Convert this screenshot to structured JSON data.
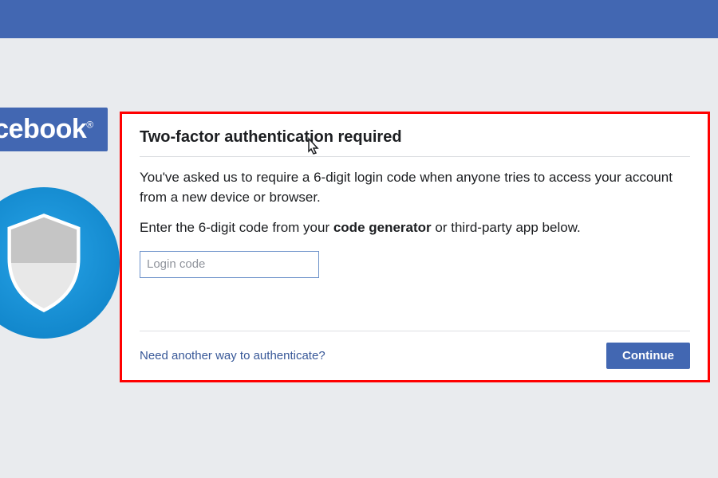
{
  "brand": {
    "name": "facebook",
    "icon_name": "shield-icon"
  },
  "dialog": {
    "heading": "Two-factor authentication required",
    "description_line1": "You've asked us to require a 6-digit login code when anyone tries to access your account from a new device or browser.",
    "enter_prefix": "Enter the 6-digit code from your ",
    "code_generator_label": "code generator",
    "enter_suffix": " or third-party app below.",
    "input_placeholder": "Login code",
    "alt_auth_link": "Need another way to authenticate?",
    "continue_label": "Continue"
  },
  "colors": {
    "brand_blue": "#4267b2",
    "highlight_red": "#ff0000",
    "shield_blue": "#0a7dc2"
  }
}
